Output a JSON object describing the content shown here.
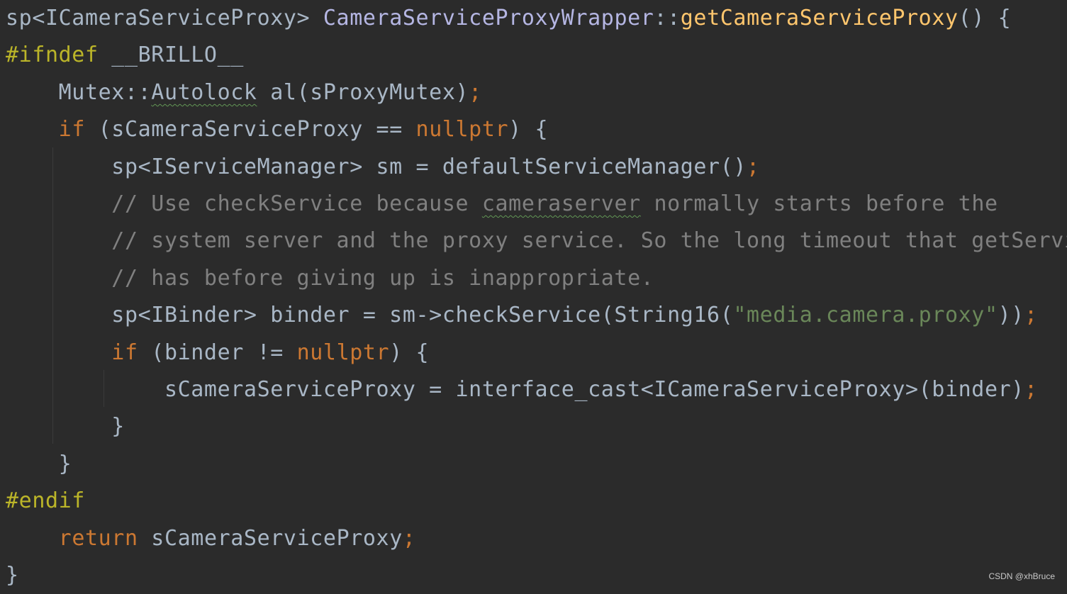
{
  "editor": {
    "lines": [
      {
        "tokens": [
          {
            "text": "sp<ICameraServiceProxy> ",
            "kind": "default"
          },
          {
            "text": "CameraServiceProxyWrapper",
            "kind": "class"
          },
          {
            "text": "::",
            "kind": "default"
          },
          {
            "text": "getCameraServiceProxy",
            "kind": "func"
          },
          {
            "text": "() {",
            "kind": "default"
          }
        ]
      },
      {
        "tokens": [
          {
            "text": "#ifndef ",
            "kind": "macro"
          },
          {
            "text": "__BRILLO__",
            "kind": "default"
          }
        ]
      },
      {
        "tokens": [
          {
            "text": "    Mutex::",
            "kind": "default"
          },
          {
            "text": "Autolock",
            "kind": "default",
            "typo": true
          },
          {
            "text": " al(sProxyMutex)",
            "kind": "default"
          },
          {
            "text": ";",
            "kind": "semicolon"
          }
        ]
      },
      {
        "tokens": [
          {
            "text": "    ",
            "kind": "default"
          },
          {
            "text": "if",
            "kind": "keyword"
          },
          {
            "text": " (sCameraServiceProxy == ",
            "kind": "default"
          },
          {
            "text": "nullptr",
            "kind": "keyword"
          },
          {
            "text": ") {",
            "kind": "default"
          }
        ]
      },
      {
        "tokens": [
          {
            "text": "        sp<IServiceManager> sm = defaultServiceManager()",
            "kind": "default"
          },
          {
            "text": ";",
            "kind": "semicolon"
          }
        ]
      },
      {
        "tokens": [
          {
            "text": "        // Use checkService because ",
            "kind": "comment"
          },
          {
            "text": "cameraserver",
            "kind": "comment",
            "typo": true
          },
          {
            "text": " normally starts before the",
            "kind": "comment"
          }
        ]
      },
      {
        "tokens": [
          {
            "text": "        // system server and the proxy service. So the long timeout that getService",
            "kind": "comment"
          }
        ]
      },
      {
        "tokens": [
          {
            "text": "        // has before giving up is inappropriate.",
            "kind": "comment"
          }
        ]
      },
      {
        "tokens": [
          {
            "text": "        sp<IBinder> binder = sm->checkService(String16(",
            "kind": "default"
          },
          {
            "text": "\"media.camera.proxy\"",
            "kind": "string"
          },
          {
            "text": "))",
            "kind": "default"
          },
          {
            "text": ";",
            "kind": "semicolon"
          }
        ]
      },
      {
        "tokens": [
          {
            "text": "        ",
            "kind": "default"
          },
          {
            "text": "if",
            "kind": "keyword"
          },
          {
            "text": " (binder != ",
            "kind": "default"
          },
          {
            "text": "nullptr",
            "kind": "keyword"
          },
          {
            "text": ") {",
            "kind": "default"
          }
        ]
      },
      {
        "tokens": [
          {
            "text": "            sCameraServiceProxy = interface_cast<ICameraServiceProxy>(binder)",
            "kind": "default"
          },
          {
            "text": ";",
            "kind": "semicolon"
          }
        ]
      },
      {
        "tokens": [
          {
            "text": "        }",
            "kind": "default"
          }
        ]
      },
      {
        "tokens": [
          {
            "text": "    }",
            "kind": "default"
          }
        ]
      },
      {
        "tokens": [
          {
            "text": "#endif",
            "kind": "macro"
          }
        ]
      },
      {
        "tokens": [
          {
            "text": "    ",
            "kind": "default"
          },
          {
            "text": "return",
            "kind": "keyword"
          },
          {
            "text": " sCameraServiceProxy",
            "kind": "default"
          },
          {
            "text": ";",
            "kind": "semicolon"
          }
        ]
      },
      {
        "tokens": [
          {
            "text": "}",
            "kind": "default"
          }
        ]
      }
    ]
  },
  "watermark": {
    "text": "CSDN @xhBruce"
  },
  "colors": {
    "background": "#2b2b2b",
    "default": "#a9b7c6",
    "keyword": "#cc7832",
    "macro": "#bbb529",
    "function": "#ffc66d",
    "class": "#b5b6e3",
    "string": "#6a8759",
    "comment": "#808080",
    "typo_underline": "#629755"
  }
}
